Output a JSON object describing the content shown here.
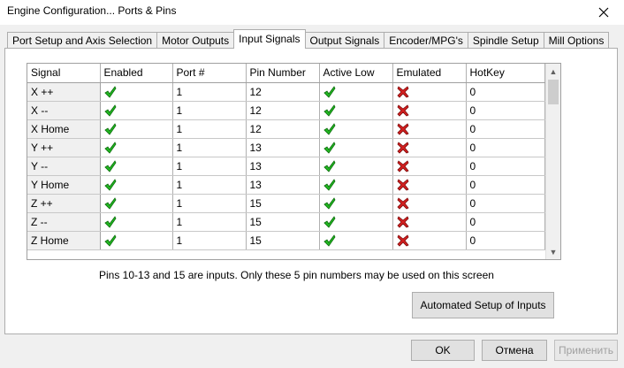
{
  "window": {
    "title": "Engine Configuration... Ports & Pins"
  },
  "tabs": [
    {
      "label": "Port Setup and Axis Selection",
      "active": false
    },
    {
      "label": "Motor Outputs",
      "active": false
    },
    {
      "label": "Input Signals",
      "active": true
    },
    {
      "label": "Output Signals",
      "active": false
    },
    {
      "label": "Encoder/MPG's",
      "active": false
    },
    {
      "label": "Spindle Setup",
      "active": false
    },
    {
      "label": "Mill Options",
      "active": false
    }
  ],
  "grid": {
    "columns": [
      "Signal",
      "Enabled",
      "Port #",
      "Pin Number",
      "Active Low",
      "Emulated",
      "HotKey"
    ],
    "rows": [
      {
        "signal": "X ++",
        "enabled": true,
        "port": "1",
        "pin": "12",
        "active_low": true,
        "emulated": false,
        "hotkey": "0"
      },
      {
        "signal": "X --",
        "enabled": true,
        "port": "1",
        "pin": "12",
        "active_low": true,
        "emulated": false,
        "hotkey": "0"
      },
      {
        "signal": "X Home",
        "enabled": true,
        "port": "1",
        "pin": "12",
        "active_low": true,
        "emulated": false,
        "hotkey": "0"
      },
      {
        "signal": "Y ++",
        "enabled": true,
        "port": "1",
        "pin": "13",
        "active_low": true,
        "emulated": false,
        "hotkey": "0"
      },
      {
        "signal": "Y --",
        "enabled": true,
        "port": "1",
        "pin": "13",
        "active_low": true,
        "emulated": false,
        "hotkey": "0"
      },
      {
        "signal": "Y Home",
        "enabled": true,
        "port": "1",
        "pin": "13",
        "active_low": true,
        "emulated": false,
        "hotkey": "0"
      },
      {
        "signal": "Z ++",
        "enabled": true,
        "port": "1",
        "pin": "15",
        "active_low": true,
        "emulated": false,
        "hotkey": "0"
      },
      {
        "signal": "Z --",
        "enabled": true,
        "port": "1",
        "pin": "15",
        "active_low": true,
        "emulated": false,
        "hotkey": "0"
      },
      {
        "signal": "Z Home",
        "enabled": true,
        "port": "1",
        "pin": "15",
        "active_low": true,
        "emulated": false,
        "hotkey": "0"
      }
    ]
  },
  "info_text": "Pins 10-13 and 15 are inputs. Only these 5 pin numbers may be used on this screen",
  "buttons": {
    "automated_setup": "Automated Setup of Inputs",
    "ok": "OK",
    "cancel": "Отмена",
    "apply": "Применить"
  },
  "icons": {
    "check": "green-check-icon",
    "cross": "red-x-icon",
    "close": "close-icon"
  },
  "colors": {
    "check": "#22b822",
    "cross": "#d42020"
  }
}
